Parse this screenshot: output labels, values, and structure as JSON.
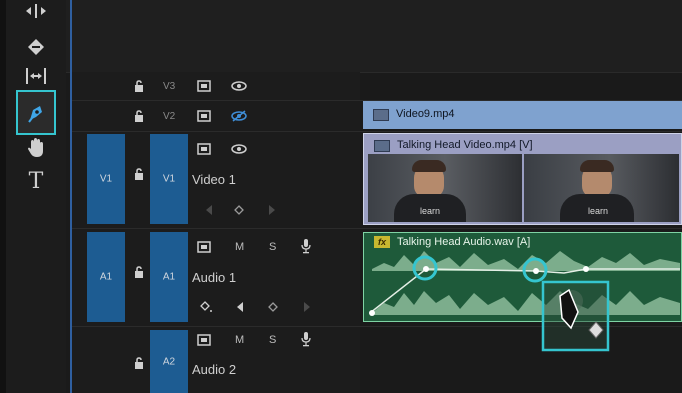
{
  "tracks": {
    "v3": {
      "label": "V3"
    },
    "v2": {
      "label": "V2"
    },
    "v1": {
      "source_label": "V1",
      "label": "V1",
      "name": "Video 1"
    },
    "a1": {
      "source_label": "A1",
      "label": "A1",
      "name": "Audio 1",
      "mute": "M",
      "solo": "S"
    },
    "a2": {
      "label": "A2",
      "name": "Audio 2",
      "mute": "M",
      "solo": "S"
    }
  },
  "clips": {
    "video9": {
      "name": "Video9.mp4"
    },
    "talking_head_video": {
      "name": "Talking Head Video.mp4 [V]",
      "frame_caption": "learn"
    },
    "talking_head_audio": {
      "name": "Talking Head Audio.wav [A]",
      "fx_badge": "fx"
    }
  },
  "toolbar": {
    "selected_tool": "pen-tool",
    "type_tool": "T"
  },
  "colors": {
    "accent": "#35c5cf",
    "track_blue": "#1d5c92",
    "video_clip": "#7fa2cf",
    "audio_clip": "#1e5a3a"
  }
}
